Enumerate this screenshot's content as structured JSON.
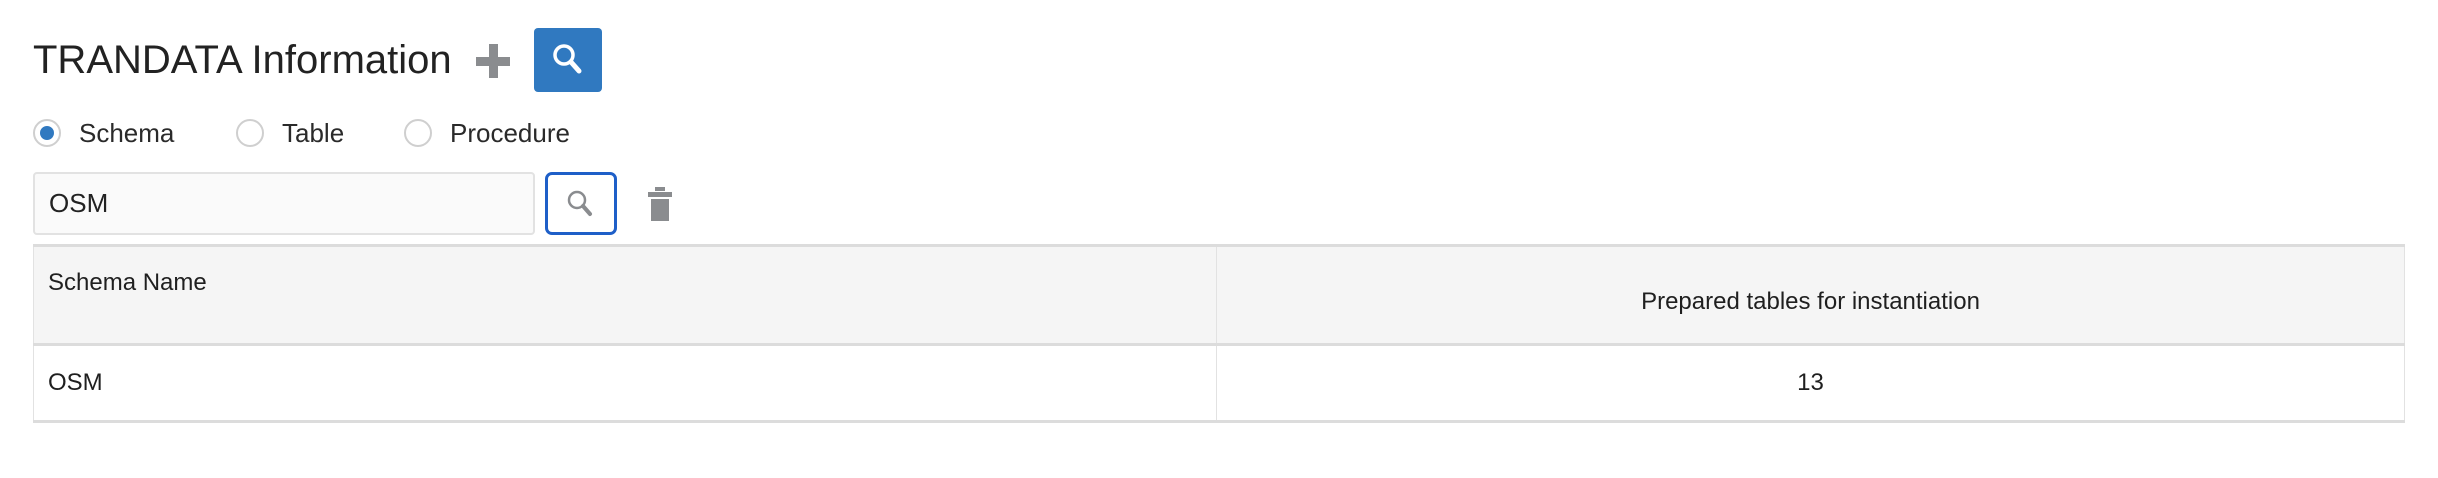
{
  "header": {
    "title": "TRANDATA Information",
    "add_icon": "plus-icon",
    "search_icon": "search-icon"
  },
  "colors": {
    "accent": "#3079c0",
    "focus_border": "#1e5fc8",
    "icon_gray": "#8a8c8f"
  },
  "radios": [
    {
      "label": "Schema",
      "checked": true
    },
    {
      "label": "Table",
      "checked": false
    },
    {
      "label": "Procedure",
      "checked": false
    }
  ],
  "filter": {
    "value": "OSM"
  },
  "table": {
    "columns": [
      "Schema Name",
      "Prepared tables for instantiation"
    ],
    "rows": [
      [
        "OSM",
        "13"
      ]
    ]
  }
}
